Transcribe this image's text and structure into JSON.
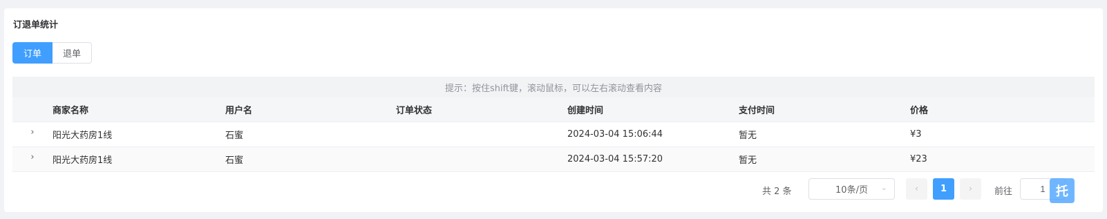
{
  "card": {
    "title": "订退单统计"
  },
  "tabs": [
    {
      "label": "订单",
      "active": true
    },
    {
      "label": "退单",
      "active": false
    }
  ],
  "table": {
    "hint": "提示：按住shift键，滚动鼠标，可以左右滚动查看内容",
    "headers": [
      "商家名称",
      "用户名",
      "订单状态",
      "创建时间",
      "支付时间",
      "价格"
    ],
    "rows": [
      [
        "阳光大药房1线",
        "石蜜",
        "",
        "2024-03-04 15:06:44",
        "暂无",
        "¥3"
      ],
      [
        "阳光大药房1线",
        "石蜜",
        "",
        "2024-03-04 15:57:20",
        "暂无",
        "¥23"
      ]
    ],
    "expand_icon": "›"
  },
  "pagination": {
    "total": "共 2 条",
    "page_size": "10条/页",
    "prev": "‹",
    "current": "1",
    "next": "›",
    "goto_label": "前往",
    "goto_value": "1"
  },
  "float_button": {
    "label": "托"
  },
  "colors": {
    "accent": "#409eff",
    "header_bg": "#f5f6f8",
    "hint_bg": "#f2f3f5"
  }
}
